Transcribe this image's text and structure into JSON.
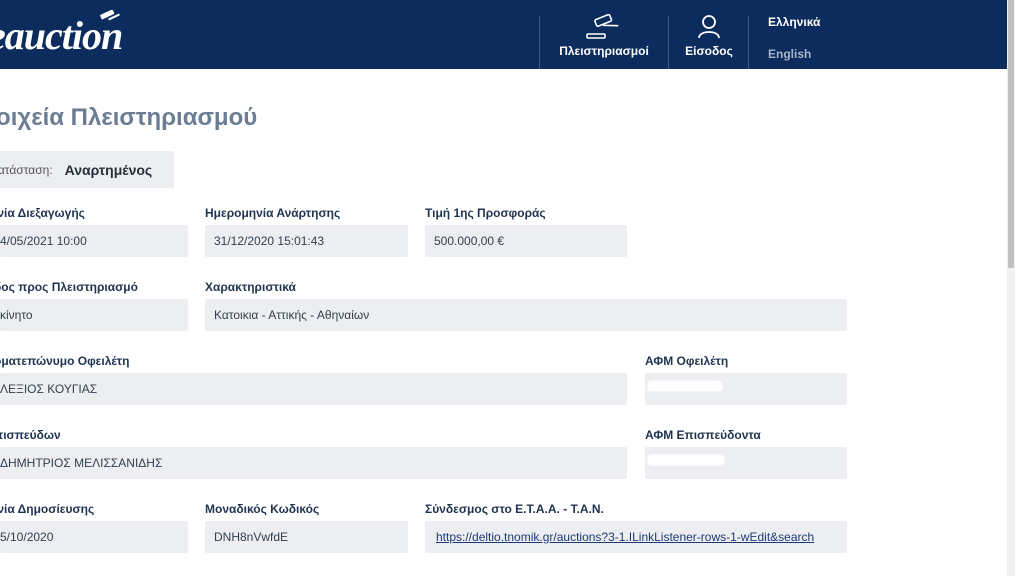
{
  "header": {
    "logo_text": "eauction",
    "nav": {
      "auctions_label": "Πλειστηριασμοί",
      "login_label": "Είσοδος"
    },
    "languages": {
      "greek": "Ελληνικά",
      "english": "English"
    },
    "background_color": "#0b2c5c"
  },
  "page": {
    "title": "τοιχεία Πλειστηριασμού",
    "status": {
      "label": "Κατάσταση:",
      "value": "Αναρτημένος"
    }
  },
  "fields": {
    "auction_date": {
      "label": "/νία Διεξαγωγής",
      "value": "4/05/2021 10:00"
    },
    "posting_date": {
      "label": "Ημερομηνία Ανάρτησης",
      "value": "31/12/2020 15:01:43"
    },
    "first_bid_price": {
      "label": "Τιμή 1ης Προσφοράς",
      "value": "500.000,00 €"
    },
    "auction_type": {
      "label": "δος προς Πλειστηριασμό",
      "value": "κίνητο"
    },
    "characteristics": {
      "label": "Χαρακτηριστικά",
      "value": "Κατοικια - Αττικής - Αθηναίων"
    },
    "debtor_name": {
      "label": "οματεπώνυμο Οφειλέτη",
      "value": "ΛΕΞΙΟΣ ΚΟΥΓΙΑΣ"
    },
    "debtor_vat": {
      "label": "ΑΦΜ Οφειλέτη",
      "value": ""
    },
    "creditor_name": {
      "label": "πισπεύδων",
      "value": "ΔΗΜΗΤΡΙΟΣ ΜΕΛΙΣΣΑΝΙΔΗΣ"
    },
    "creditor_vat": {
      "label": "ΑΦΜ Επισπεύδοντα",
      "value": ""
    },
    "publication_date": {
      "label": "/νία Δημοσίευσης",
      "value": "5/10/2020"
    },
    "unique_code": {
      "label": "Μοναδικός Κωδικός",
      "value": "DNH8nVwfdE"
    },
    "etaa_link": {
      "label": "Σύνδεσμος στο Ε.Τ.Α.Α. - Τ.Α.Ν.",
      "value": "https://deltio.tnomik.gr/auctions?3-1.ILinkListener-rows-1-wEdit&search"
    }
  },
  "icons": {
    "gavel": "gavel-icon",
    "user": "user-icon"
  }
}
